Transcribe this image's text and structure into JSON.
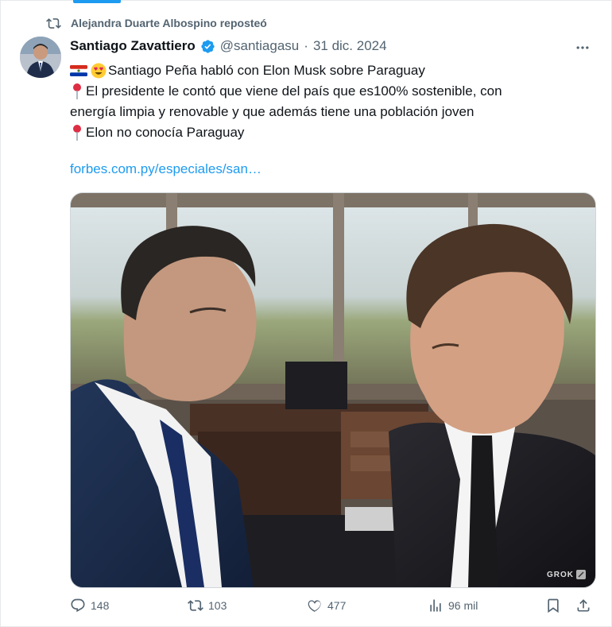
{
  "repost": {
    "label": "Alejandra Duarte Albospino reposteó",
    "icon": "repost-icon"
  },
  "post": {
    "author_name": "Santiago Zavattiero",
    "author_handle": "@santiagasu",
    "separator": "·",
    "date": "31 dic. 2024",
    "lines": [
      "Santiago Peña habló con Elon Musk sobre Paraguay",
      "El presidente le contó que viene del país que es100% sostenible, con",
      "energía limpia y renovable y que además tiene una población joven",
      "Elon no conocía Paraguay"
    ],
    "link": "forbes.com.py/especiales/san…",
    "media_watermark": "GROK"
  },
  "actions": {
    "replies": "148",
    "reposts": "103",
    "likes": "477",
    "views": "96 mil"
  },
  "colors": {
    "accent": "#1d9bf0",
    "muted": "#536471",
    "text": "#0f1419"
  }
}
